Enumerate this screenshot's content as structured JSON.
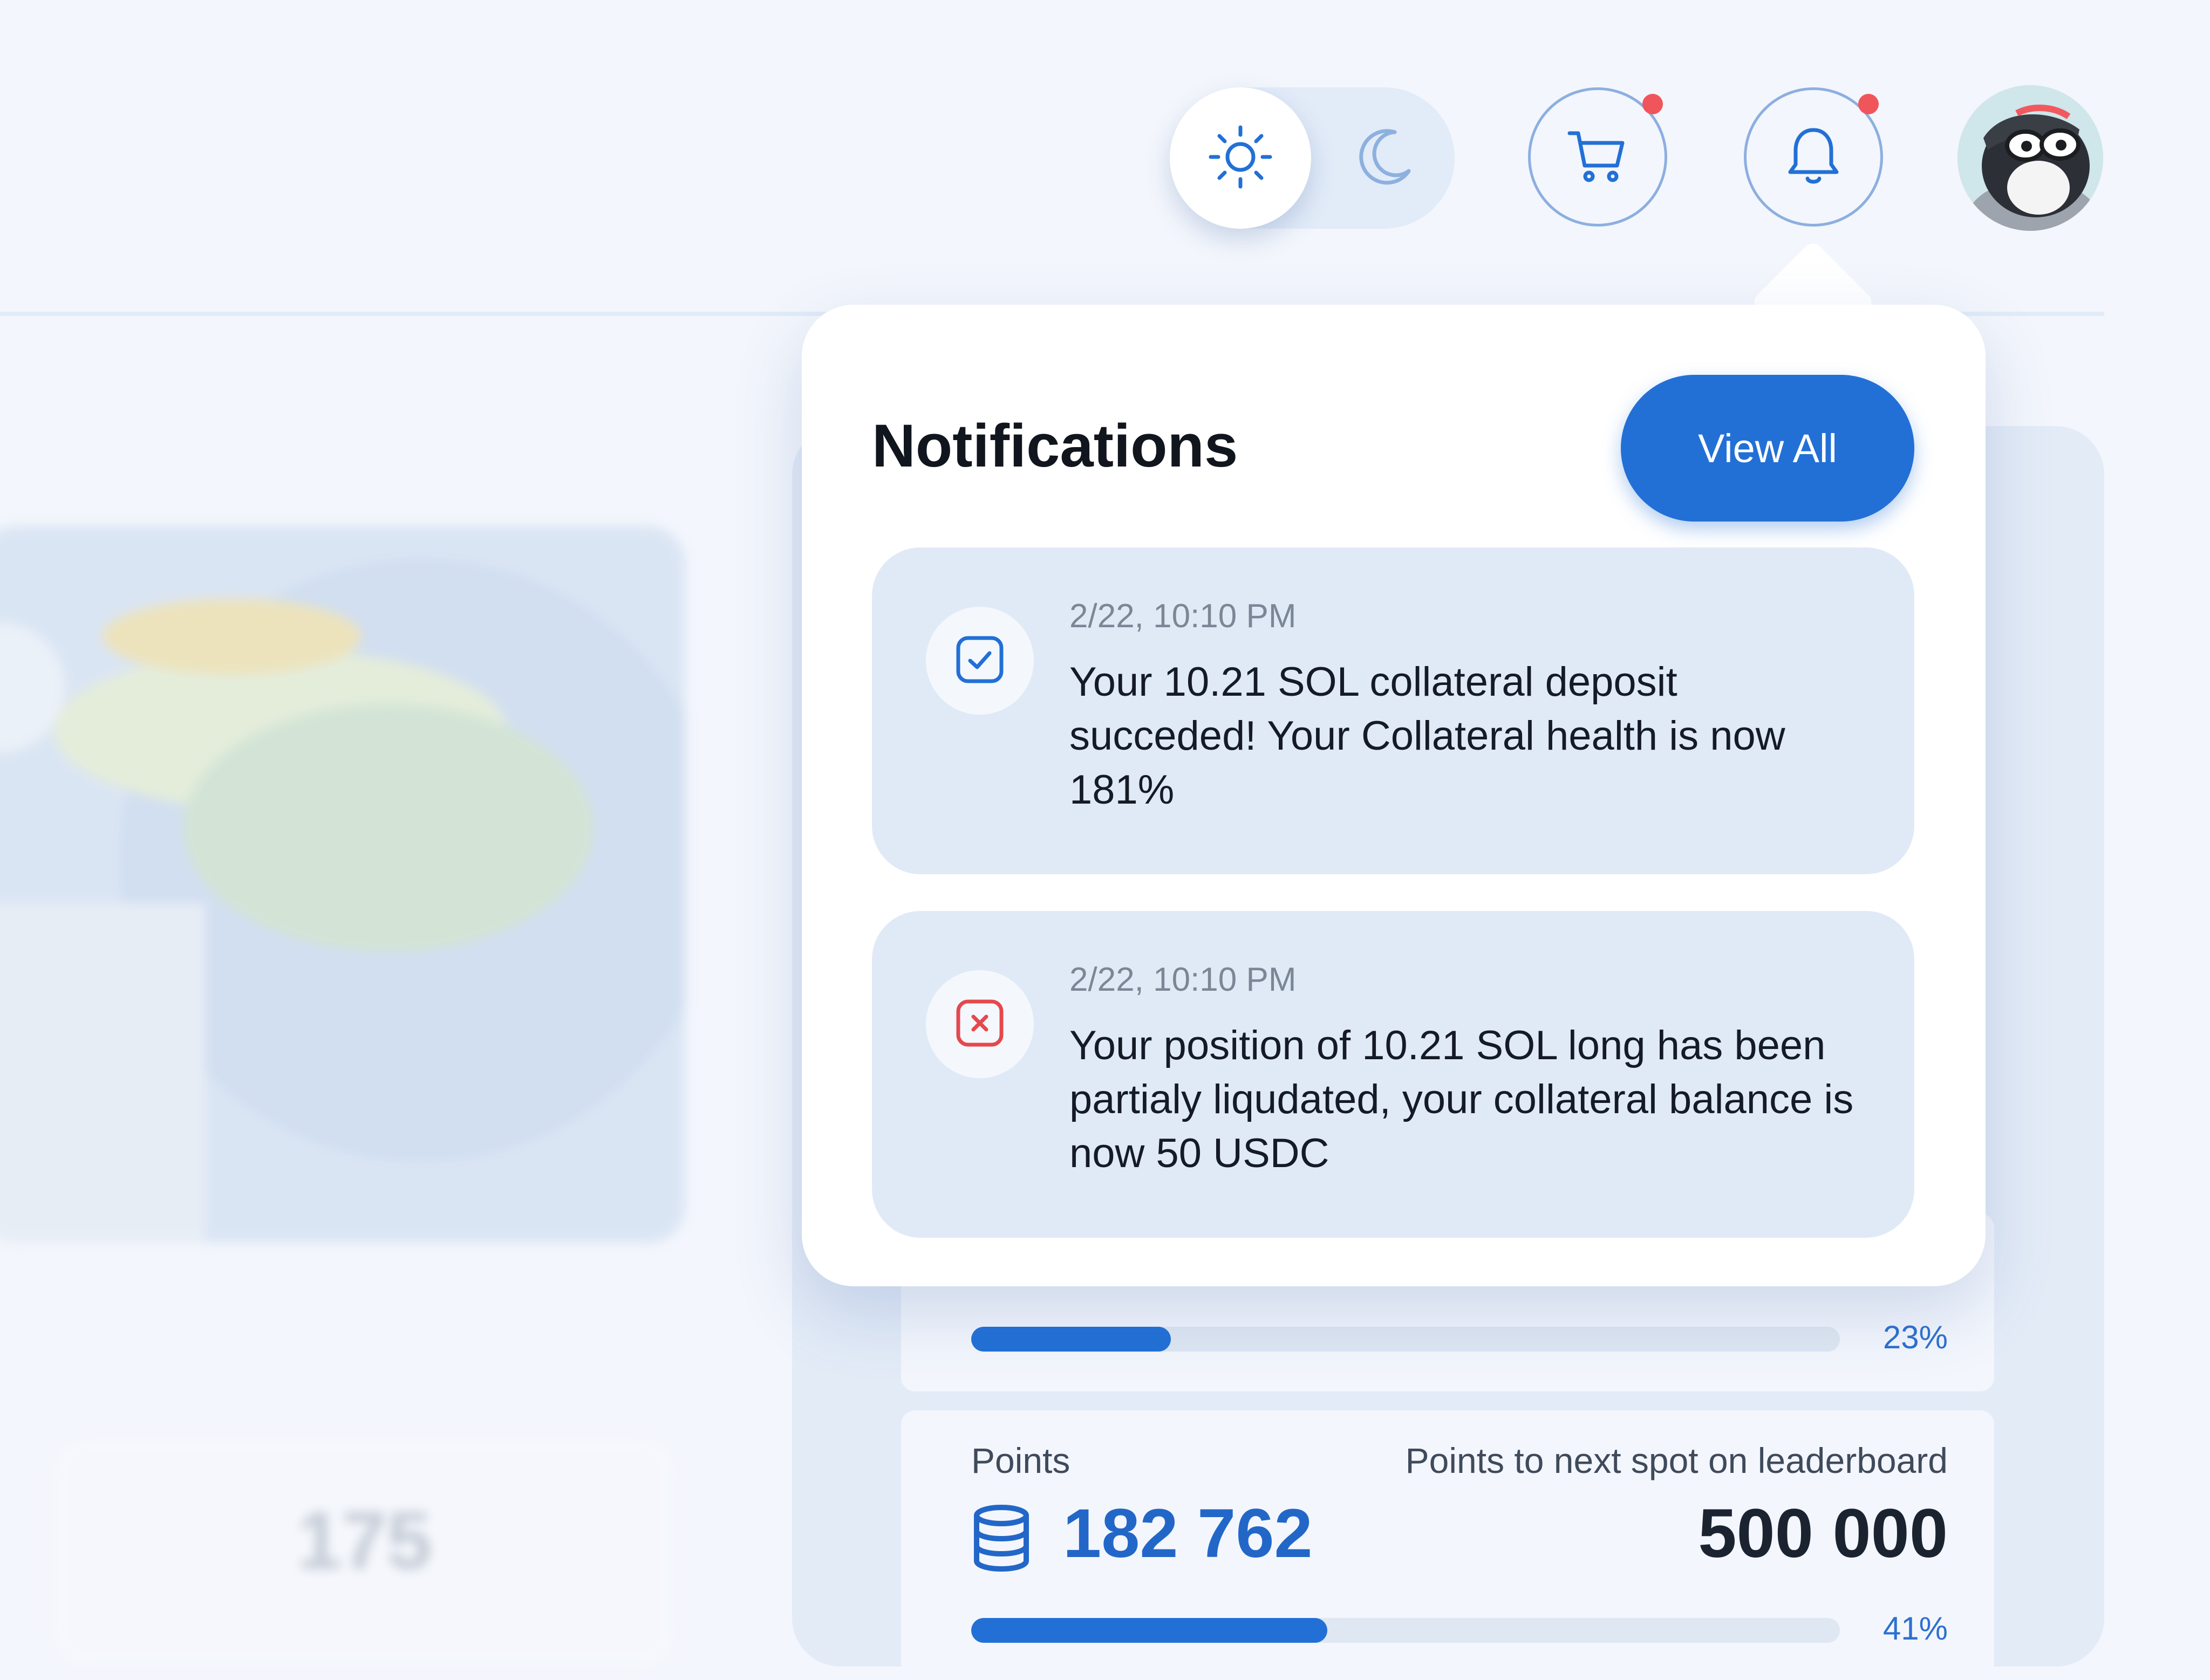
{
  "topbar": {
    "theme_toggle": {
      "options": [
        "sun-icon",
        "moon-icon"
      ],
      "selected": "light"
    },
    "cart": {
      "icon": "cart-icon",
      "has_unread": true
    },
    "notifications": {
      "icon": "bell-icon",
      "has_unread": true
    },
    "avatar": {
      "icon": "user-avatar"
    }
  },
  "background": {
    "stat_value": "175"
  },
  "progress_cards": [
    {
      "percent_label": "23%",
      "progress": 0.23
    },
    {
      "label_left": "Points",
      "label_right": "Points to next spot on leaderboard",
      "points": "182 762",
      "points_next": "500 000",
      "percent_label": "41%",
      "progress": 0.41
    }
  ],
  "notifications_popover": {
    "title": "Notifications",
    "view_all_label": "View All",
    "items": [
      {
        "status": "success",
        "icon": "check-square-icon",
        "time": "2/22, 10:10 PM",
        "message": "Your 10.21 SOL collateral deposit succeded! Your Collateral health is now 181%"
      },
      {
        "status": "error",
        "icon": "x-square-icon",
        "time": "2/22, 10:10 PM",
        "message": "Your position of 10.21 SOL long has been partialy liqudated, your collateral balance is now 50 USDC"
      }
    ]
  },
  "colors": {
    "accent": "#2270d6",
    "background": "#f3f6fc",
    "notification_card": "#e0eaf7",
    "badge": "#f0555b",
    "error": "#e5484d"
  }
}
